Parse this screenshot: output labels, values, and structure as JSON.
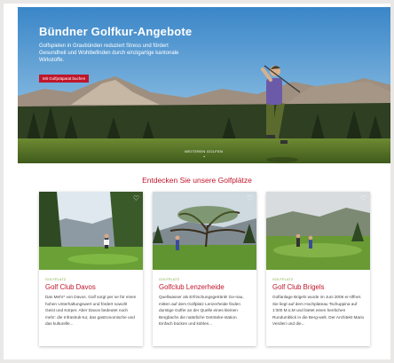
{
  "hero": {
    "title": "Bündner Golfkur-Angebote",
    "subtitle": "Golfspielen in Graubünden reduziert Stress und fördert Gesundheit und Wohlbefinden durch einzigartige kantonale Wirkstoffe.",
    "button_label": "Mit Golfpräparat buchen",
    "more_label": "WEITEREN GOLFEN",
    "scroll_icon": "chevron-down-icon"
  },
  "section": {
    "title": "Entdecken Sie unsere Golfplätze"
  },
  "cards": [
    {
      "category": "GOLFPLATZ",
      "title": "Golf Club Davos",
      "text": "Das Mehr* von Davos. Golf sorgt per se für einen hohen Unterhaltungswert und fördert sowohl Geist und Körper. Aber Davos bedeutet noch mehr: die Infrastruk-tur, das gastronomische und das kulturelle..."
    },
    {
      "category": "GOLFPLATZ",
      "title": "Golfclub Lenzerheide",
      "text": "Quellwasser als Erfrischungsgetränk! Ge-nau, mitten auf dem Golfplatz Lenzerheide finden durstige Golfer an der Quelle eines kleinen Bergbachs die natürliche Getränke-station. Einfach bücken und kühlen..."
    },
    {
      "category": "GOLFPLATZ",
      "title": "Golf Club Brigels",
      "text": "Golfanlage Brigels wurde im Juni 2006 er-öffnet. Sie liegt auf dem Hochplateau Tschuppina auf 1'300 M.ü.M und bietet einen herrlichen Rundumblick in die Berg-welt. Der Architekt Mario Verdieri und die..."
    }
  ],
  "colors": {
    "accent": "#c0162b",
    "category": "#78a83c"
  }
}
